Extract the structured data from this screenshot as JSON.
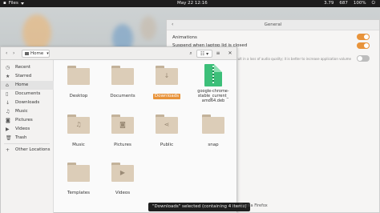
{
  "topbar": {
    "app_name": "Files",
    "clock": "May 22  12:16",
    "net_speed": "3.79",
    "load": "687",
    "battery": "100%"
  },
  "settings": {
    "title": "General",
    "animations_label": "Animations",
    "suspend_label": "Suspend when laptop lid is closed",
    "volume_note": "can result in a loss of audio quality; it is better to increase application volume",
    "toggles": {
      "animations": true,
      "suspend": true,
      "volume": false
    }
  },
  "files": {
    "location": "Home",
    "sidebar": [
      {
        "label": "Recent",
        "icon": "clock-icon"
      },
      {
        "label": "Starred",
        "icon": "star-icon"
      },
      {
        "label": "Home",
        "icon": "home-icon",
        "active": true
      },
      {
        "label": "Documents",
        "icon": "document-icon"
      },
      {
        "label": "Downloads",
        "icon": "download-icon"
      },
      {
        "label": "Music",
        "icon": "music-icon"
      },
      {
        "label": "Pictures",
        "icon": "picture-icon"
      },
      {
        "label": "Videos",
        "icon": "video-icon"
      },
      {
        "label": "Trash",
        "icon": "trash-icon"
      },
      {
        "label": "Other Locations",
        "icon": "plus-icon"
      }
    ],
    "items": [
      {
        "label": "Desktop",
        "icon": "folder-icon",
        "glyph": ""
      },
      {
        "label": "Documents",
        "icon": "folder-icon",
        "glyph": ""
      },
      {
        "label": "Downloads",
        "icon": "folder-icon",
        "glyph": "↓",
        "selected": true
      },
      {
        "label": "google-chrome-stable_current_amd64.deb",
        "label_lines": [
          "google-chrome-",
          "stable_current_",
          "amd64.deb"
        ],
        "icon": "deb-package-icon"
      },
      {
        "label": "Music",
        "icon": "folder-icon",
        "glyph": "♫"
      },
      {
        "label": "Pictures",
        "icon": "folder-icon",
        "glyph": "◙"
      },
      {
        "label": "Public",
        "icon": "folder-icon",
        "glyph": "⋖"
      },
      {
        "label": "snap",
        "icon": "folder-icon",
        "glyph": ""
      },
      {
        "label": "Templates",
        "icon": "folder-icon",
        "glyph": ""
      },
      {
        "label": "Videos",
        "icon": "folder-icon",
        "glyph": "▶"
      }
    ]
  },
  "status_message": "\"Downloads\" selected (containing 4 items)",
  "firefox_label": "- Mozilla Firefox",
  "colors": {
    "accent": "#e8933a",
    "folder": "#dccdb8"
  }
}
